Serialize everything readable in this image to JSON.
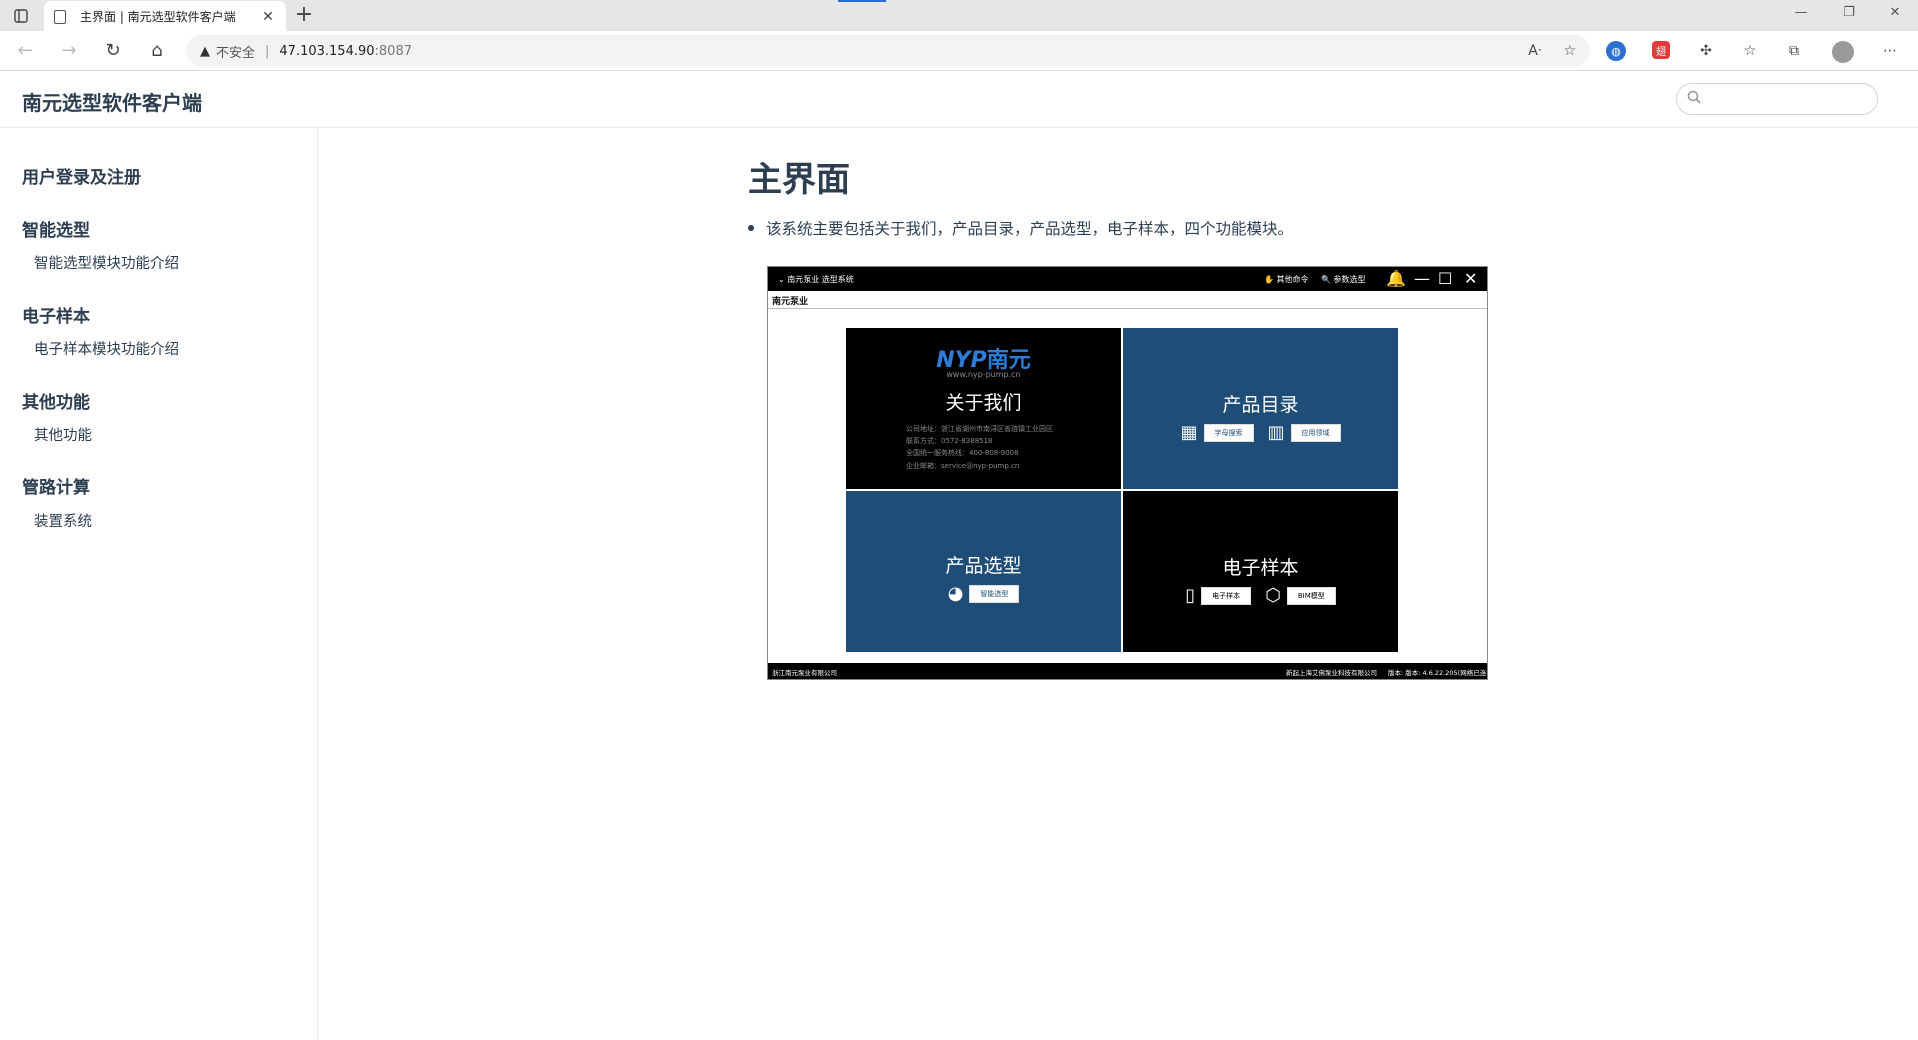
{
  "browser": {
    "tab_title": "主界面 | 南元选型软件客户端",
    "tab_close": "✕",
    "new_tab": "+",
    "insecure_label": "不安全",
    "url_host": "47.103.154.90",
    "url_port": ":8087",
    "red_ext_label": "翅"
  },
  "site": {
    "title": "南元选型软件客户端",
    "search_placeholder": ""
  },
  "sidebar": {
    "groups": [
      {
        "label": "用户登录及注册",
        "items": []
      },
      {
        "label": "智能选型",
        "items": [
          "智能选型模块功能介绍"
        ]
      },
      {
        "label": "电子样本",
        "items": [
          "电子样本模块功能介绍"
        ]
      },
      {
        "label": "其他功能",
        "items": [
          "其他功能"
        ]
      },
      {
        "label": "管路计算",
        "items": [
          "装置系统"
        ]
      }
    ]
  },
  "main": {
    "title": "主界面",
    "bullet": "该系统主要包括关于我们，产品目录，产品选型，电子样本，四个功能模块。"
  },
  "screenshot": {
    "app_name": "南元泵业 选型系统",
    "tool_other": "其他命令",
    "tool_param": "参数选型",
    "tab_label": "南元泵业",
    "logo_latin": "NYP",
    "logo_cn": "南元",
    "site_url": "www.nyp-pump.cn",
    "about_title": "关于我们",
    "about_lines": [
      "公司地址：浙江省湖州市南浔区善琏镇工业园区",
      "联系方式：0572-8388518",
      "全国统一服务热线：400-808-9008",
      "企业邮箱：service@nyp-pump.cn"
    ],
    "catalog_title": "产品目录",
    "catalog_btn_1": "字母搜索",
    "catalog_btn_2": "应用领域",
    "select_title": "产品选型",
    "select_btn": "智能选型",
    "sample_title": "电子样本",
    "sample_btn_1": "电子样本",
    "sample_btn_2": "BIM模型",
    "footer_left": "浙江南元泵业有限公司",
    "footer_mid": "新起上海艾佛泵业科技有限公司",
    "footer_right": "版本: 版本: 4.6.22.205(网络已连接)"
  }
}
